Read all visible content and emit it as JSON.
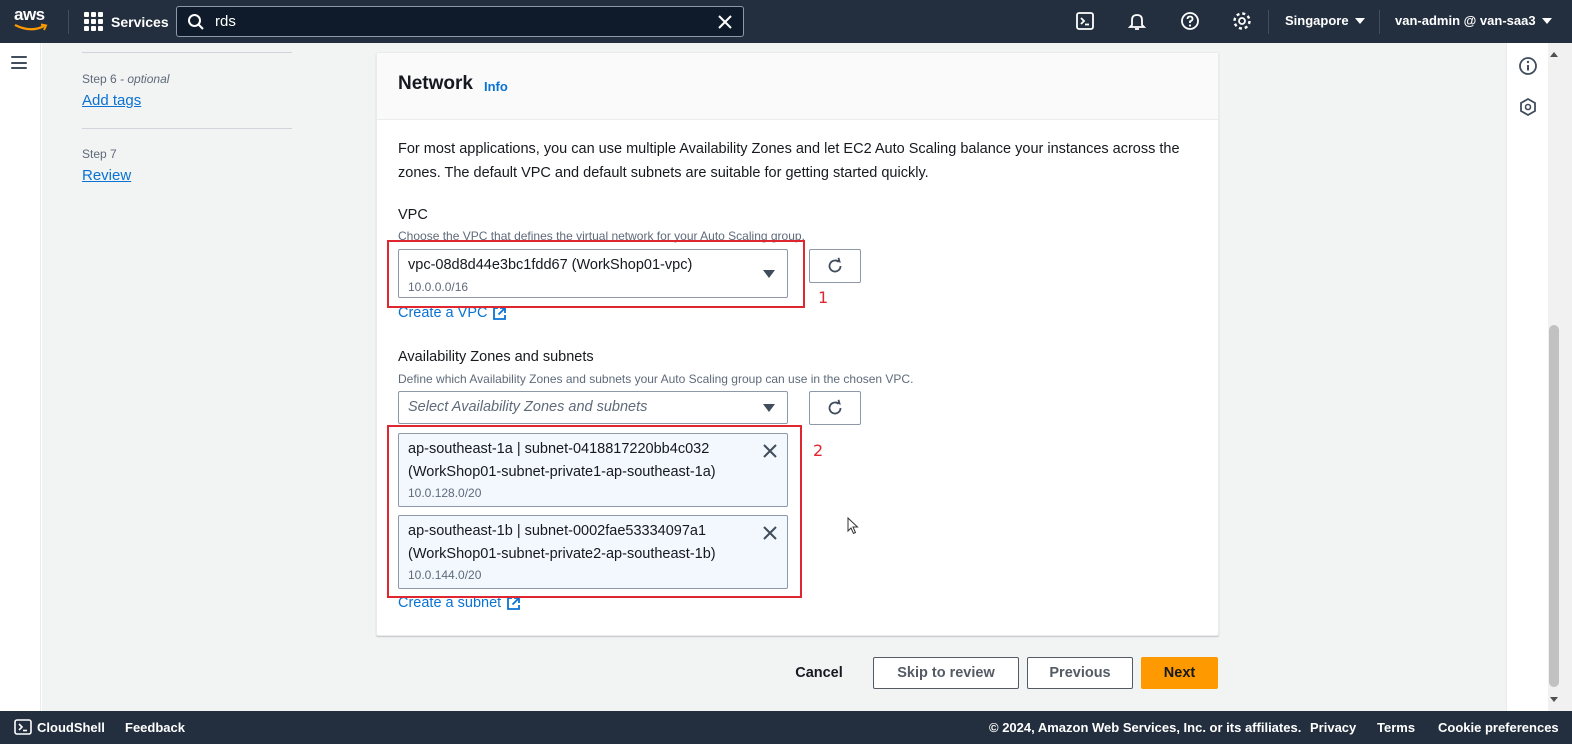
{
  "topnav": {
    "logo_text": "aws",
    "services_label": "Services",
    "search_value": "rds",
    "region": "Singapore",
    "account": "van-admin @ van-saa3",
    "icons": [
      "cloudshell-icon",
      "bell-icon",
      "help-icon",
      "gear-icon"
    ]
  },
  "steps": [
    {
      "meta": "Step 6",
      "optional": " - optional",
      "link": "Add tags"
    },
    {
      "meta": "Step 7",
      "optional": "",
      "link": "Review"
    }
  ],
  "panel": {
    "title": "Network",
    "info": "Info",
    "intro": "For most applications, you can use multiple Availability Zones and let EC2 Auto Scaling balance your instances across the zones. The default VPC and default subnets are suitable for getting started quickly.",
    "vpc": {
      "label": "VPC",
      "description": "Choose the VPC that defines the virtual network for your Auto Scaling group.",
      "selected": "vpc-08d8d44e3bc1fdd67 (WorkShop01-vpc)",
      "cidr": "10.0.0.0/16",
      "create_link": "Create a VPC"
    },
    "az": {
      "label": "Availability Zones and subnets",
      "description": "Define which Availability Zones and subnets your Auto Scaling group can use in the chosen VPC.",
      "placeholder": "Select Availability Zones and subnets",
      "tokens": [
        {
          "line1": "ap-southeast-1a | subnet-0418817220bb4c032",
          "line2": "(WorkShop01-subnet-private1-ap-southeast-1a)",
          "cidr": "10.0.128.0/20"
        },
        {
          "line1": "ap-southeast-1b | subnet-0002fae53334097a1",
          "line2": "(WorkShop01-subnet-private2-ap-southeast-1b)",
          "cidr": "10.0.144.0/20"
        }
      ],
      "create_link": "Create a subnet"
    }
  },
  "annotations": {
    "label1": "1",
    "label2": "2",
    "color": "#e0262e"
  },
  "buttons": {
    "cancel": "Cancel",
    "skip": "Skip to review",
    "previous": "Previous",
    "next": "Next"
  },
  "footer": {
    "cloudshell": "CloudShell",
    "feedback": "Feedback",
    "copyright": "© 2024, Amazon Web Services, Inc. or its affiliates.",
    "privacy": "Privacy",
    "terms": "Terms",
    "cookies": "Cookie preferences"
  },
  "colors": {
    "nav_bg": "#232f3e",
    "link": "#0972d3",
    "primary": "#ff9900"
  }
}
